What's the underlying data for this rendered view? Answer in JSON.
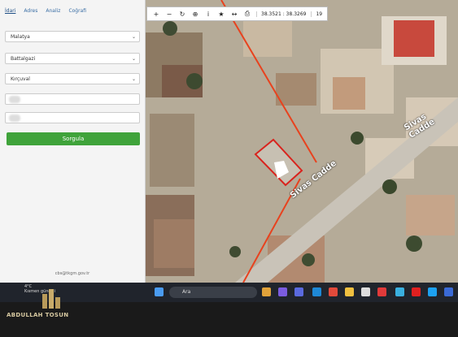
{
  "tabs": [
    "İdari",
    "Adres",
    "Analiz",
    "Coğrafi"
  ],
  "form": {
    "province": "Malatya",
    "district": "Battalgazi",
    "neighborhood": "Kırçuval",
    "query_button": "Sorgula",
    "footer_email": "cbs@tkgm.gov.tr"
  },
  "map_toolbar": {
    "zoom_in": "+",
    "zoom_out": "−",
    "refresh": "↻",
    "locate": "⊕",
    "info": "i",
    "star": "★",
    "measure": "↔",
    "print": "⎙",
    "coordinates": "38.3521 : 38.3269",
    "zoom_level": "19"
  },
  "map": {
    "road_label_1": "Sivas Cadde",
    "road_label_2": "Sivas Cadde",
    "parcel_color": "#d9231d",
    "road_line_color": "#e8421e"
  },
  "taskbar": {
    "search_placeholder": "Ara",
    "weather_temp": "4°C",
    "weather_text": "Kısmen güneşli"
  },
  "watermark": "ABDULLAH TOSUN"
}
